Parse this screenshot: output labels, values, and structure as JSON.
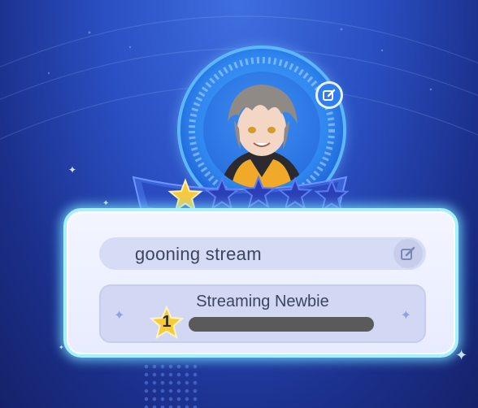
{
  "profile": {
    "name": "gooning stream",
    "title": "Streaming Newbie",
    "level": "1",
    "rank_stars_filled": 1,
    "rank_stars_total": 5,
    "progress_fraction": 0.0
  },
  "icons": {
    "avatar_edit": "pencil-square-icon",
    "name_edit": "pencil-square-icon",
    "level_badge": "star-icon",
    "rank_star_filled": "star-icon",
    "rank_star_empty": "star-icon"
  },
  "colors": {
    "star_gold": "#f7c93c",
    "star_empty": "#2b3fb6",
    "card_glow": "#a7f0ff",
    "progress_track": "#5a5a5a"
  }
}
